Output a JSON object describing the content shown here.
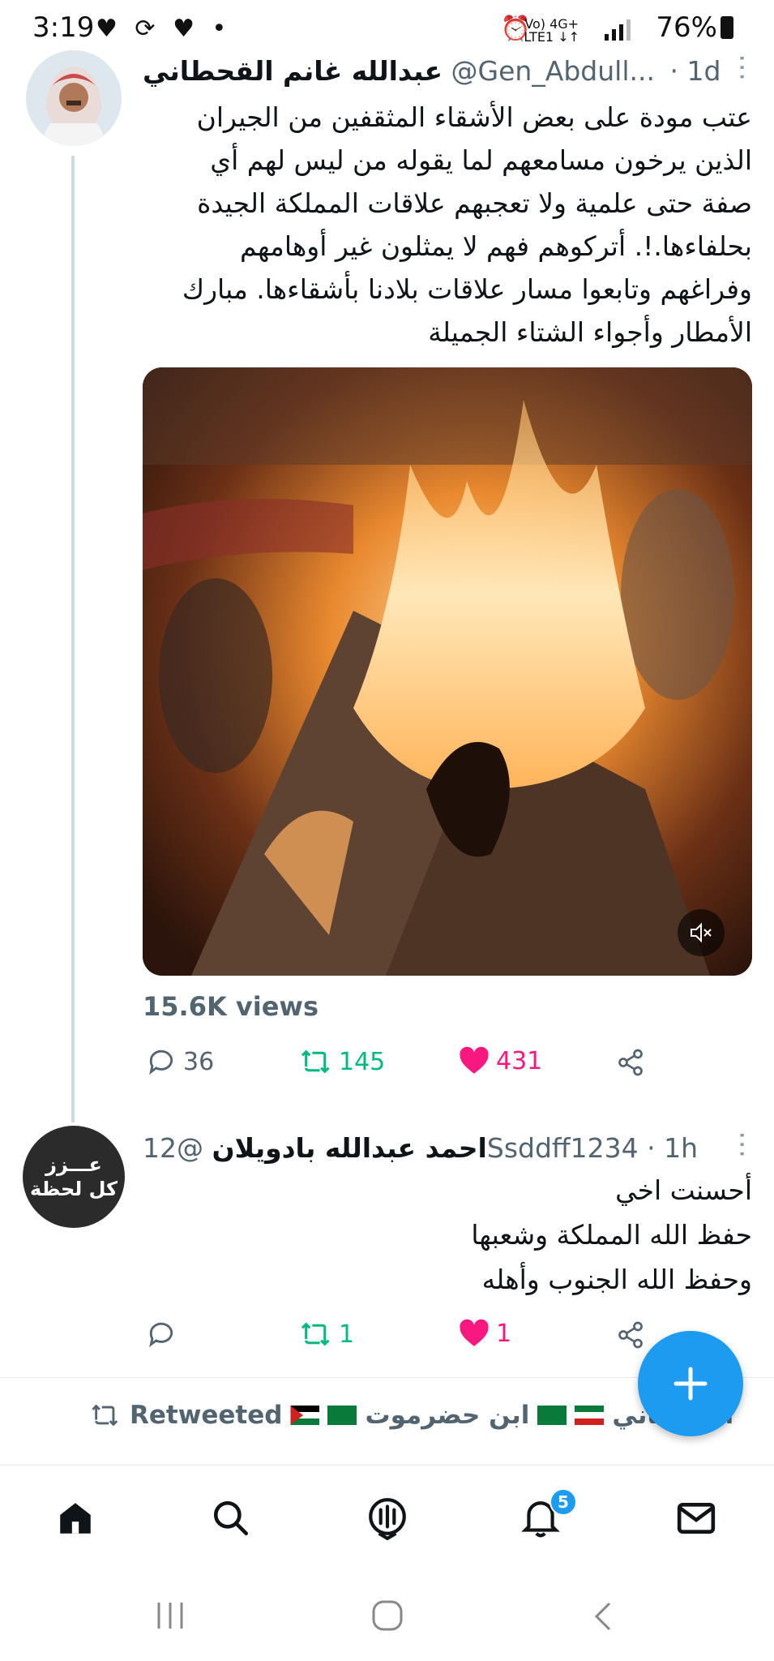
{
  "status_bar": {
    "time": "3:19",
    "left_icons": "♥ ⟳ ♥ •",
    "network_top": "Vo) 4G+",
    "network_bottom": "LTE1 ↓↑",
    "battery": "76%"
  },
  "tweet": {
    "display_name": "عبدالله غانم القحطاني",
    "handle": "@Gen_Abdull...",
    "time": "· 1d",
    "text": "عتب مودة على بعض الأشقاء المثقفين من الجيران\nالذين يرخون مسامعهم لما يقوله من ليس لهم أي\nصفة حتى علمية ولا تعجبهم علاقات المملكة الجيدة\nبحلفاءها.!. أتركوهم فهم لا يمثلون غير أوهامهم\nوفراغهم وتابعوا مسار علاقات بلادنا بأشقاءها. مبارك\nالأمطار وأجواء الشتاء الجميلة",
    "views": "15.6K views",
    "replies": "36",
    "retweets": "145",
    "likes": "431"
  },
  "reply": {
    "avatar_text_1": "عـــزز",
    "avatar_text_2": "كل لحظة",
    "display_name": "احمد عبدالله بادويلان",
    "handle": "@12Ssddff1234",
    "time": "· 1h",
    "text": "أحسنت اخي\nحفظ الله المملكة وشعبها\nوحفظ الله الجنوب وأهله",
    "replies": "",
    "retweets": "1",
    "likes": "1"
  },
  "retweet_banner": {
    "label": "Retweeted",
    "names": "ابن حضرموت",
    "name_cut": "الحـ  طاني"
  },
  "bottom_nav": {
    "notification_count": "5"
  },
  "colors": {
    "accent": "#1d9bf0",
    "retweet": "#00ba7c",
    "like": "#f91880",
    "secondary": "#536471"
  },
  "icons": [
    "home-icon",
    "search-icon",
    "spaces-icon",
    "notifications-icon",
    "messages-icon",
    "reply-icon",
    "retweet-icon",
    "heart-icon",
    "share-icon",
    "mute-icon",
    "compose-icon"
  ]
}
